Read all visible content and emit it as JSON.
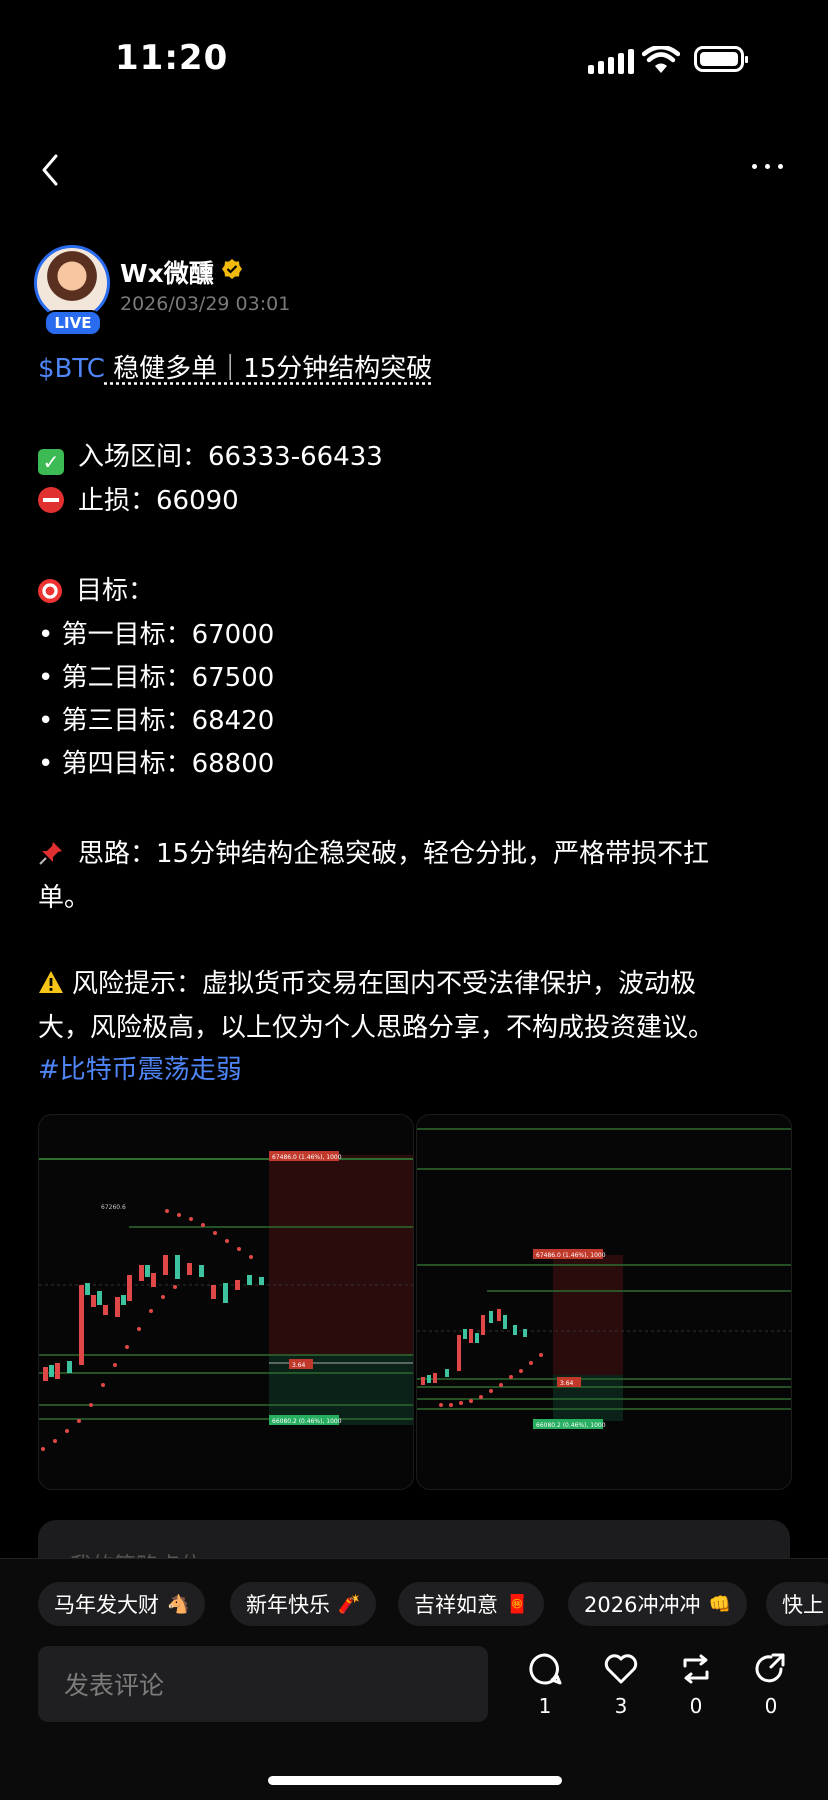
{
  "status_bar": {
    "time": "11:20"
  },
  "author": {
    "name": "Wx微醺",
    "live_badge": "LIVE",
    "timestamp": "2026/03/29 03:01"
  },
  "post": {
    "title_ticker": "$BTC",
    "title_rest": " 稳健多单｜15分钟结构突破",
    "entry_label": "入场区间：66333-66433",
    "stop_label": "止损：66090",
    "targets_heading": "目标：",
    "targets": [
      "• 第一目标：67000",
      "• 第二目标：67500",
      "• 第三目标：68420",
      "• 第四目标：68800"
    ],
    "idea_line1": "思路：15分钟结构企稳突破，轻仓分批，严格带损不扛",
    "idea_line2": "单。",
    "risk_line1": "风险提示：虚拟货币交易在国内不受法律保护，波动极",
    "risk_line2": "大，风险极高，以上仅为个人思路分享，不构成投资建议。",
    "hashtag": "#比特币震荡走弱"
  },
  "chart_images": {
    "left": {
      "target_label": "67486.0 (1.46%), 1000",
      "mid_label": "3.64",
      "stop_label": "66080.2 (0.46%), 1000",
      "high_label": "67260.6"
    },
    "right": {
      "target_label": "67486.0 (1.46%), 1000",
      "mid_label": "3.64",
      "stop_label": "66080.2 (0.46%), 1000"
    }
  },
  "hidden_card_text": "我的策略点位",
  "topic_chips": [
    {
      "label": "马年发大财",
      "emoji": "🐴"
    },
    {
      "label": "新年快乐",
      "emoji": "🧨"
    },
    {
      "label": "吉祥如意",
      "emoji": "🧧"
    },
    {
      "label": "2026冲冲冲",
      "emoji": "👊"
    },
    {
      "label": "快上",
      "emoji": ""
    }
  ],
  "comment_placeholder": "发表评论",
  "actions": {
    "comments": "1",
    "likes": "3",
    "reposts": "0",
    "shares": "0"
  },
  "colors": {
    "accent": "#4f86f7",
    "live": "#2a6cf0",
    "background": "#000000"
  }
}
